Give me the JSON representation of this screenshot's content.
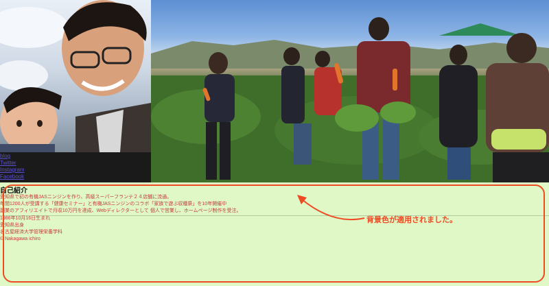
{
  "photos": {
    "selfie_description": "portrait-photo",
    "field_description": "carrot-harvest-photo"
  },
  "sns": {
    "links": [
      {
        "label": "blog"
      },
      {
        "label": "Twitter"
      },
      {
        "label": "Instagram"
      },
      {
        "label": "Facebook"
      }
    ]
  },
  "profile": {
    "heading": "自己紹介",
    "lines": [
      "愛知県で初の有機JASニンジンを作り、高級スーパーフランテ２４店舗に流通。",
      "年間1200人が受講する「健康セミナー」と有機JASニンジンのコラボ「家族で遊ぶ収穫祭」を10年開催中",
      "副業のアフィリエイトで月収10万円を達成、Webディレクターとして 個人で営業し、ホームページ制作を受注。",
      "1986年10月16日生まれ",
      "愛知県出身",
      "名古屋経済大学管理栄養学科",
      "© Nakagawa ichiro"
    ],
    "background_color": "#dff8c5",
    "text_color": "#c63c3c"
  },
  "annotation": {
    "callout": "背景色が適用されました。",
    "color": "#ee4a23"
  }
}
